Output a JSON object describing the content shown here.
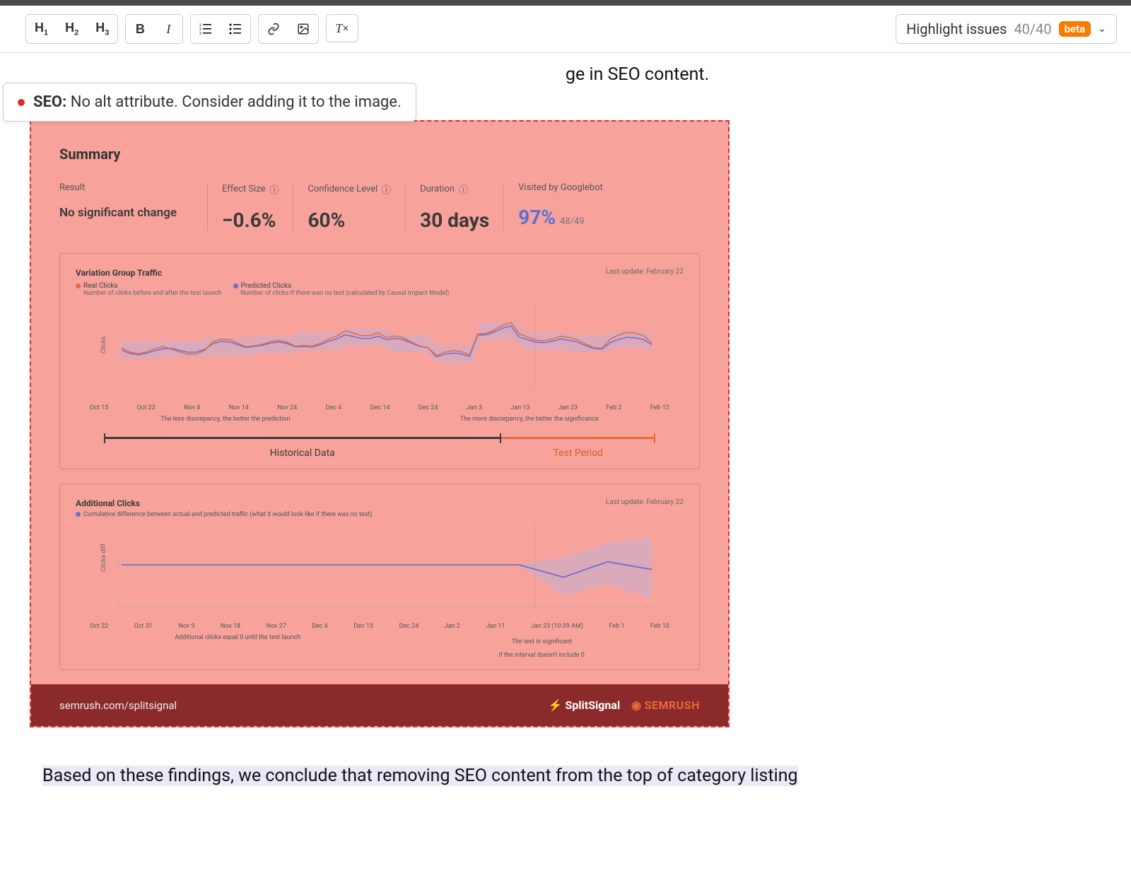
{
  "toolbar": {
    "highlight_label": "Highlight issues",
    "count": "40/40",
    "beta_label": "beta"
  },
  "tooltip": {
    "tag": "SEO:",
    "msg": "No alt attribute. Consider adding it to the image."
  },
  "partial_line": "ge in SEO content.",
  "summary": {
    "title": "Summary",
    "result_label": "Result",
    "result_value": "No significant change",
    "effect_label": "Effect Size",
    "effect_value": "−0.6%",
    "conf_label": "Confidence Level",
    "conf_value": "60%",
    "dur_label": "Duration",
    "dur_value": "30 days",
    "google_label": "Visited by Googlebot",
    "google_value": "97%",
    "google_sub": "48/49"
  },
  "chart1": {
    "title": "Variation Group Traffic",
    "last_update": "Last update: February 22",
    "legend_real": "Real Clicks",
    "legend_real_sub": "Number of clicks before and after the test launch",
    "legend_pred": "Predicted Clicks",
    "legend_pred_sub": "Number of clicks if there was no test (calculated by Causal Impact Model)",
    "ylabel": "Clicks",
    "note_left": "The less discrepancy, the better the prediction",
    "note_right": "The more discrepancy, the better the significance",
    "ticks": [
      "Oct 15",
      "Oct 23",
      "Nov 4",
      "Nov 14",
      "Nov 24",
      "Dec 4",
      "Dec 14",
      "Dec 24",
      "Jan 3",
      "Jan 13",
      "Jan 23",
      "Feb 2",
      "Feb 12"
    ],
    "hist_label": "Historical Data",
    "test_label": "Test Period"
  },
  "chart2": {
    "title": "Additional Clicks",
    "subtitle": "Cumulative difference between actual and predicted traffic (what it would look like if there was no test)",
    "last_update": "Last update: February 22",
    "ylabel": "Clicks diff",
    "note_left": "Additional clicks equal 0 until the test launch",
    "note_right_1": "The test is significant",
    "note_right_2": "if the interval doesn't include 0",
    "ticks": [
      "Oct 22",
      "Oct 31",
      "Nov 9",
      "Nov 18",
      "Nov 27",
      "Dec 6",
      "Dec 15",
      "Dec 24",
      "Jan 2",
      "Jan 11",
      "Jan 23 (10:39 AM)",
      "Feb 1",
      "Feb 10"
    ]
  },
  "footer": {
    "url": "semrush.com/splitsignal",
    "logo1": "SplitSignal",
    "logo2": "SEMRUSH"
  },
  "body_after": "Based on these findings, we conclude that removing SEO content from the top of category listing",
  "chart_data": [
    {
      "type": "line",
      "title": "Variation Group Traffic",
      "xlabel": "",
      "ylabel": "Clicks",
      "x": [
        "Oct 15",
        "Oct 23",
        "Nov 4",
        "Nov 14",
        "Nov 24",
        "Dec 4",
        "Dec 14",
        "Dec 24",
        "Jan 3",
        "Jan 13",
        "Jan 23",
        "Feb 2",
        "Feb 12"
      ],
      "series": [
        {
          "name": "Real Clicks",
          "color": "#e66a3c",
          "values": [
            42,
            40,
            44,
            46,
            50,
            55,
            47,
            38,
            60,
            50,
            48,
            54,
            49
          ]
        },
        {
          "name": "Predicted Clicks",
          "color": "#6b6fd3",
          "values": [
            40,
            41,
            43,
            45,
            48,
            52,
            46,
            36,
            58,
            48,
            46,
            50,
            47
          ]
        }
      ],
      "annotations": [
        {
          "label": "Historical Data",
          "range": [
            "Oct 15",
            "Jan 23"
          ]
        },
        {
          "label": "Test Period",
          "range": [
            "Jan 23",
            "Feb 12"
          ]
        }
      ]
    },
    {
      "type": "line",
      "title": "Additional Clicks",
      "xlabel": "",
      "ylabel": "Clicks diff",
      "x": [
        "Oct 22",
        "Oct 31",
        "Nov 9",
        "Nov 18",
        "Nov 27",
        "Dec 6",
        "Dec 15",
        "Dec 24",
        "Jan 2",
        "Jan 11",
        "Jan 23",
        "Feb 1",
        "Feb 10"
      ],
      "series": [
        {
          "name": "Cumulative difference",
          "color": "#6b6fd3",
          "values": [
            0,
            0,
            0,
            0,
            0,
            0,
            0,
            0,
            0,
            0,
            -8,
            2,
            -3
          ]
        }
      ],
      "confidence_band": {
        "upper": [
          0,
          0,
          0,
          0,
          0,
          0,
          0,
          0,
          0,
          0,
          5,
          14,
          18
        ],
        "lower": [
          0,
          0,
          0,
          0,
          0,
          0,
          0,
          0,
          0,
          0,
          -20,
          -12,
          -22
        ]
      },
      "zero_line": true
    }
  ]
}
